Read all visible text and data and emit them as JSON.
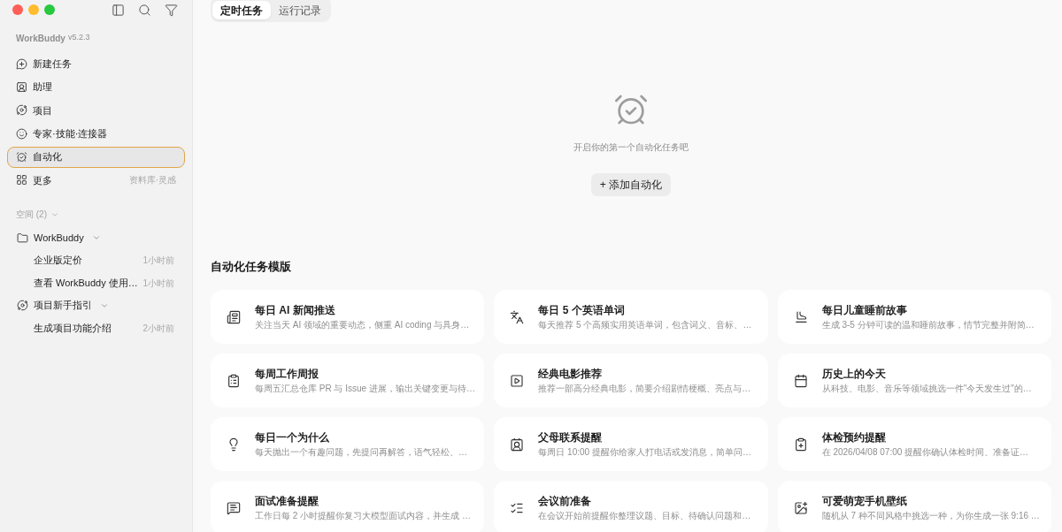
{
  "window": {
    "app_name": "WorkBuddy",
    "version": "v5.2.3"
  },
  "sidebar": {
    "nav": [
      {
        "label": "新建任务",
        "selected": false
      },
      {
        "label": "助理",
        "selected": false
      },
      {
        "label": "项目",
        "selected": false
      },
      {
        "label": "专家·技能·连接器",
        "selected": false
      },
      {
        "label": "自动化",
        "selected": true
      },
      {
        "label": "更多",
        "selected": false,
        "hint": "资料库·灵感"
      }
    ],
    "spaces": {
      "label": "空间 (2)",
      "expanded": true,
      "groups": [
        {
          "name": "WorkBuddy",
          "kind": "folder",
          "expanded": true,
          "children": [
            {
              "title": "企业版定价",
              "time": "1小时前"
            },
            {
              "title": "查看 WorkBuddy 使用…",
              "time": "1小时前"
            }
          ]
        },
        {
          "name": "项目新手指引",
          "kind": "project",
          "expanded": true,
          "children": [
            {
              "title": "生成项目功能介绍",
              "time": "2小时前"
            }
          ]
        }
      ]
    }
  },
  "tabs": [
    {
      "label": "定时任务",
      "selected": true
    },
    {
      "label": "运行记录",
      "selected": false
    }
  ],
  "empty_state": {
    "message": "开启你的第一个自动化任务吧",
    "button": "+ 添加自动化"
  },
  "templates": {
    "title": "自动化任务模版",
    "items": [
      {
        "title": "每日 AI 新闻推送",
        "description": "关注当天 AI 领域的重要动态，侧重 AI coding 与具身…"
      },
      {
        "title": "每日 5 个英语单词",
        "description": "每天推荐 5 个高频实用英语单词，包含词义、音标、…"
      },
      {
        "title": "每日儿童睡前故事",
        "description": "生成 3-5 分钟可读的温和睡前故事，情节完整并附简…"
      },
      {
        "title": "每周工作周报",
        "description": "每周五汇总仓库 PR 与 Issue 进展，输出关键变更与待…"
      },
      {
        "title": "经典电影推荐",
        "description": "推荐一部高分经典电影，简要介绍剧情梗概、亮点与…"
      },
      {
        "title": "历史上的今天",
        "description": "从科技、电影、音乐等领域挑选一件\"今天发生过\"的…"
      },
      {
        "title": "每日一个为什么",
        "description": "每天抛出一个有趣问题，先提问再解答，语气轻松、…"
      },
      {
        "title": "父母联系提醒",
        "description": "每周日 10:00 提醒你给家人打电话或发消息，简单问…"
      },
      {
        "title": "体检预约提醒",
        "description": "在 2026/04/08 07:00 提醒你确认体检时间、准备证…"
      },
      {
        "title": "面试准备提醒",
        "description": "工作日每 2 小时提醒你复习大模型面试内容，并生成 …"
      },
      {
        "title": "会议前准备",
        "description": "在会议开始前提醒你整理议题、目标、待确认问题和…"
      },
      {
        "title": "可爱萌宠手机壁纸",
        "description": "随机从 7 种不同风格中挑选一种，为你生成一张 9:16 …"
      }
    ]
  }
}
